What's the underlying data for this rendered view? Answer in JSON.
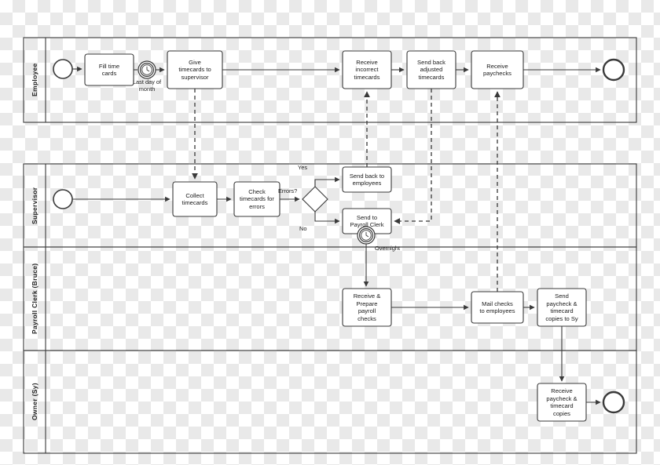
{
  "diagram": {
    "title": "Payroll process swimlane diagram",
    "type": "bpmn-swimlane",
    "stroke_color": "#3a3a3a",
    "fill_color": "#ffffff",
    "text_color": "#1a1a1a",
    "background": "transparent-checkerboard"
  },
  "lanes": [
    {
      "id": "employee",
      "label": "Employee"
    },
    {
      "id": "supervisor",
      "label": "Supervisor"
    },
    {
      "id": "payroll",
      "label": "Payroll Clerk (Bruce)"
    },
    {
      "id": "owner",
      "label": "Owner (Sy)"
    }
  ],
  "tasks": [
    {
      "id": "t1",
      "lane": "employee",
      "label": "Fill time\ncards"
    },
    {
      "id": "t2",
      "lane": "employee",
      "label": "Give\ntimecards to\nsupervisor"
    },
    {
      "id": "t3",
      "lane": "employee",
      "label": "Receive\nincorrect\ntimecards"
    },
    {
      "id": "t4",
      "lane": "employee",
      "label": "Send back\nadjusted\ntimecards"
    },
    {
      "id": "t5",
      "lane": "employee",
      "label": "Receive\npaychecks"
    },
    {
      "id": "t6",
      "lane": "supervisor",
      "label": "Collect\ntimecards"
    },
    {
      "id": "t7",
      "lane": "supervisor",
      "label": "Check\ntimecards for\nerrors"
    },
    {
      "id": "t8",
      "lane": "supervisor",
      "label": "Send back to\nemployees"
    },
    {
      "id": "t9",
      "lane": "supervisor",
      "label": "Send to\nPayroll Clerk"
    },
    {
      "id": "t10",
      "lane": "payroll",
      "label": "Receive &\nPrepare\npayroll\nchecks"
    },
    {
      "id": "t11",
      "lane": "payroll",
      "label": "Mail checks\nto employees"
    },
    {
      "id": "t12",
      "lane": "payroll",
      "label": "Send\npaycheck &\ntimecard\ncopies to Sy"
    },
    {
      "id": "t13",
      "lane": "owner",
      "label": "Receive\npaycheck &\ntimecard\ncopies"
    }
  ],
  "events": [
    {
      "id": "e_start_emp",
      "kind": "start-event",
      "lane": "employee",
      "label": ""
    },
    {
      "id": "e_timer_1",
      "kind": "timer-intermediate-event",
      "lane": "employee",
      "label": "Last day of\nmonth"
    },
    {
      "id": "e_end_emp",
      "kind": "end-event",
      "lane": "employee",
      "label": ""
    },
    {
      "id": "e_start_sup",
      "kind": "start-event",
      "lane": "supervisor",
      "label": ""
    },
    {
      "id": "e_timer_2",
      "kind": "timer-boundary-event",
      "lane": "supervisor",
      "label": "Overnight"
    },
    {
      "id": "e_end_owner",
      "kind": "end-event",
      "lane": "owner",
      "label": ""
    }
  ],
  "gateways": [
    {
      "id": "g1",
      "kind": "exclusive-gateway",
      "lane": "supervisor",
      "label": "Errors?"
    }
  ],
  "flow_labels": {
    "gateway_question": "Errors?",
    "yes": "Yes",
    "no": "No",
    "timer_1": "Last day of\nmonth",
    "timer_1_line1": "Last day of",
    "timer_1_line2": "month",
    "timer_2": "Overnight"
  },
  "message_flows": [
    {
      "from": "t2",
      "to": "t6",
      "style": "dashed"
    },
    {
      "from": "t8",
      "to": "t3",
      "style": "dashed"
    },
    {
      "from": "t4",
      "to": "t9",
      "style": "dashed"
    },
    {
      "from": "t11",
      "to": "t5",
      "style": "dashed"
    }
  ],
  "sequence_flows": [
    {
      "from": "e_start_emp",
      "to": "t1"
    },
    {
      "from": "t1",
      "to": "e_timer_1"
    },
    {
      "from": "e_timer_1",
      "to": "t2"
    },
    {
      "from": "t2",
      "to": "t3"
    },
    {
      "from": "t3",
      "to": "t4"
    },
    {
      "from": "t4",
      "to": "t5"
    },
    {
      "from": "t5",
      "to": "e_end_emp"
    },
    {
      "from": "e_start_sup",
      "to": "t6"
    },
    {
      "from": "t6",
      "to": "t7"
    },
    {
      "from": "t7",
      "to": "g1"
    },
    {
      "from": "g1",
      "to": "t8",
      "label": "Yes"
    },
    {
      "from": "g1",
      "to": "t9",
      "label": "No"
    },
    {
      "from": "e_timer_2",
      "to": "t10"
    },
    {
      "from": "t10",
      "to": "t11"
    },
    {
      "from": "t11",
      "to": "t12"
    },
    {
      "from": "t12",
      "to": "t13"
    },
    {
      "from": "t13",
      "to": "e_end_owner"
    }
  ]
}
